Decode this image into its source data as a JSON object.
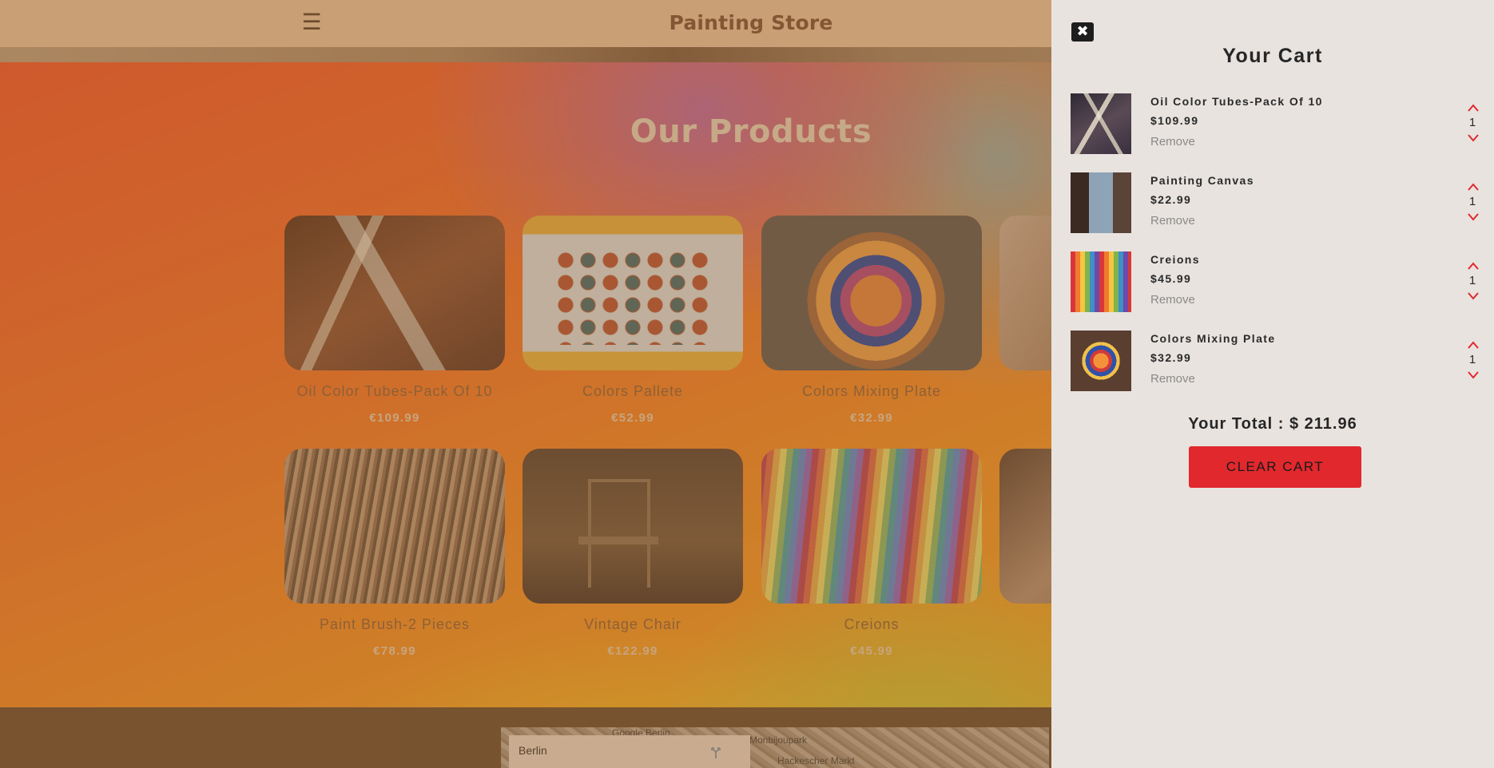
{
  "navbar": {
    "brand": "Painting Store",
    "menu_icon": "hamburger-icon"
  },
  "products_section": {
    "title": "Our Products",
    "items": [
      {
        "name": "Oil Color Tubes-Pack Of 10",
        "price": "€109.99"
      },
      {
        "name": "Colors Pallete",
        "price": "€52.99"
      },
      {
        "name": "Colors Mixing Plate",
        "price": "€32.99"
      },
      {
        "name": "Paint Brush-2 Pieces",
        "price": "€78.99"
      },
      {
        "name": "Vintage Chair",
        "price": "€122.99"
      },
      {
        "name": "Creions",
        "price": "€45.99"
      }
    ]
  },
  "map": {
    "city": "Berlin",
    "label_1": "Google Berlin",
    "label_2": "Monbijoupark",
    "label_3": "Hackescher Markt"
  },
  "cart": {
    "title": "Your Cart",
    "close_icon": "close-icon",
    "items": [
      {
        "title": "Oil Color Tubes-Pack Of 10",
        "price": "$109.99",
        "remove": "Remove",
        "qty": "1"
      },
      {
        "title": "Painting Canvas",
        "price": "$22.99",
        "remove": "Remove",
        "qty": "1"
      },
      {
        "title": "Creions",
        "price": "$45.99",
        "remove": "Remove",
        "qty": "1"
      },
      {
        "title": "Colors Mixing Plate",
        "price": "$32.99",
        "remove": "Remove",
        "qty": "1"
      }
    ],
    "total": "Your Total : $ 211.96",
    "clear_button": "CLEAR CART",
    "accent_color": "#e0282d"
  }
}
